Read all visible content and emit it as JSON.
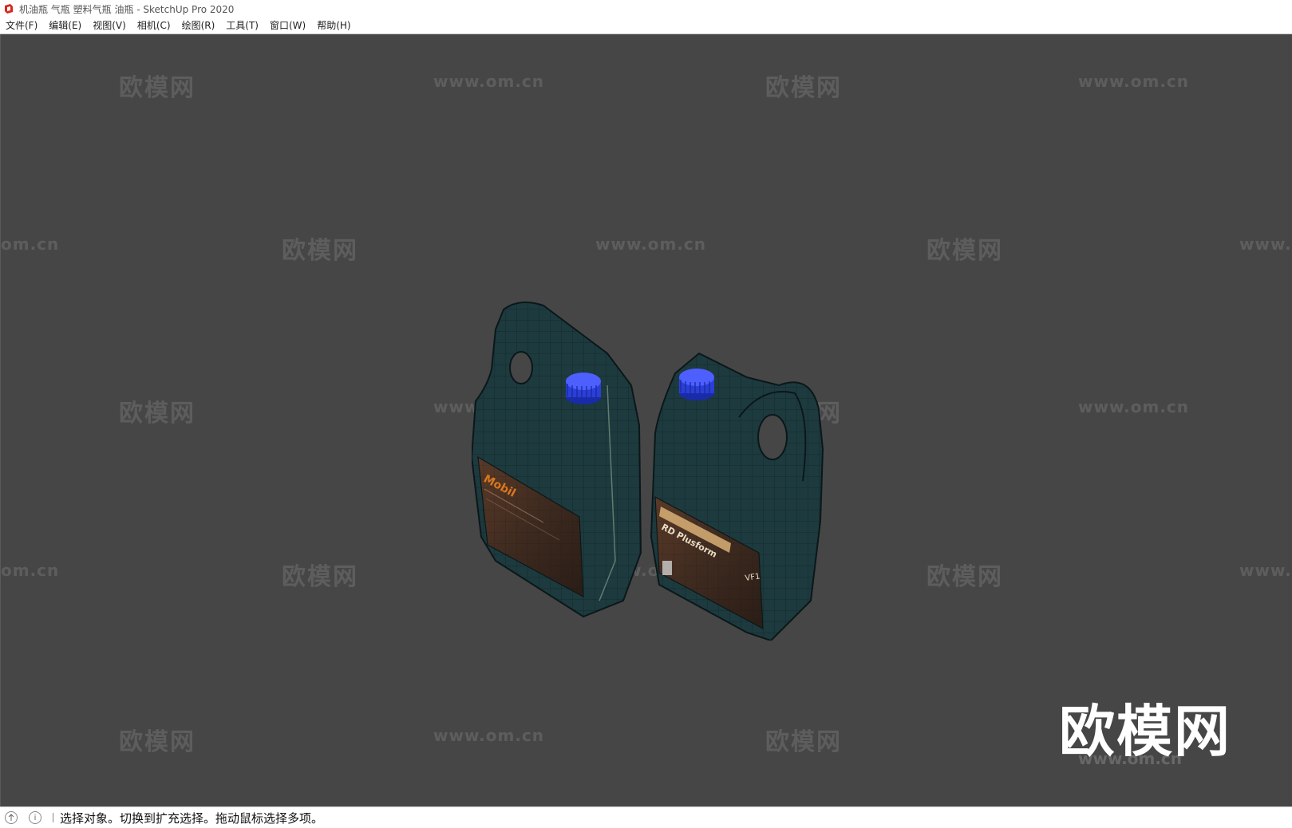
{
  "window": {
    "title": "机油瓶 气瓶 塑料气瓶 油瓶 - SketchUp Pro 2020",
    "icon": "sketchup-logo-icon",
    "accent": "#d9261c"
  },
  "menu": [
    {
      "label": "文件(F)"
    },
    {
      "label": "编辑(E)"
    },
    {
      "label": "视图(V)"
    },
    {
      "label": "相机(C)"
    },
    {
      "label": "绘图(R)"
    },
    {
      "label": "工具(T)"
    },
    {
      "label": "窗口(W)"
    },
    {
      "label": "帮助(H)"
    }
  ],
  "viewport": {
    "background": "#464646",
    "watermark_cn": "欧模网",
    "watermark_url": "www.om.cn",
    "watermark_url_clipped": "om.cn",
    "watermark_url_clipped_right": "www.",
    "logo_text": "欧模网",
    "logo_url": "www.om.cn",
    "bottle_left_brand": "Mobil",
    "bottle_right_label": "RD Plusform",
    "bottle_right_code": "VF1",
    "bottle_color": "#1d3a3e",
    "cap_color": "#2b3fd6"
  },
  "status": {
    "icon_1": "geo-location-icon",
    "icon_2": "info-icon",
    "text": "选择对象。切换到扩充选择。拖动鼠标选择多项。"
  }
}
